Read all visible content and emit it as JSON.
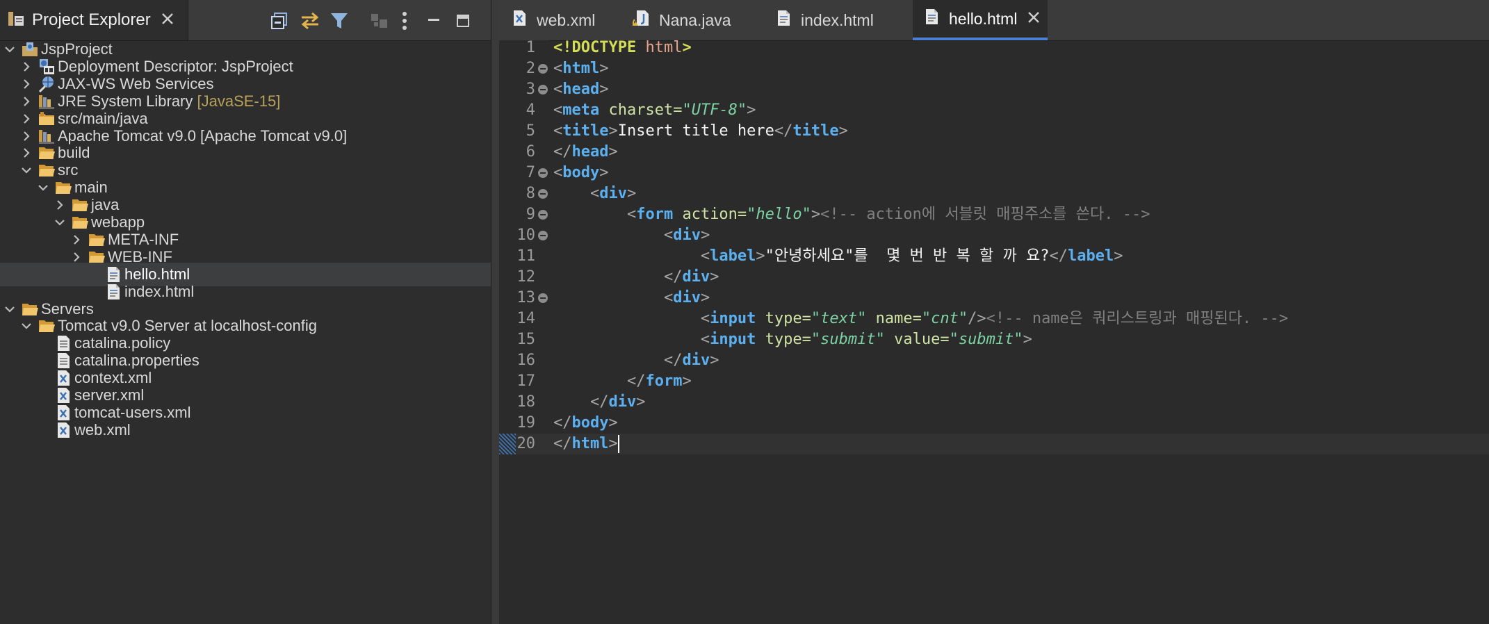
{
  "explorer": {
    "title": "Project Explorer",
    "toolbar": [
      "collapse-all-icon",
      "link-with-editor-icon",
      "filter-icon",
      "focus-icon",
      "view-menu-icon",
      "minimize-icon",
      "maximize-icon"
    ],
    "tree": [
      {
        "label": "JspProject",
        "deco": "",
        "level": 0,
        "expanded": true,
        "has_children": true,
        "icon": "project-icon"
      },
      {
        "label": "Deployment Descriptor: JspProject",
        "deco": "",
        "level": 1,
        "expanded": false,
        "has_children": true,
        "icon": "deployment-descriptor-icon"
      },
      {
        "label": "JAX-WS Web Services",
        "deco": "",
        "level": 1,
        "expanded": false,
        "has_children": true,
        "icon": "web-services-icon"
      },
      {
        "label": "JRE System Library",
        "deco": " [JavaSE-15]",
        "level": 1,
        "expanded": false,
        "has_children": true,
        "icon": "library-icon"
      },
      {
        "label": "src/main/java",
        "deco": "",
        "level": 1,
        "expanded": false,
        "has_children": true,
        "icon": "source-folder-icon"
      },
      {
        "label": "Apache Tomcat v9.0 [Apache Tomcat v9.0]",
        "deco": "",
        "level": 1,
        "expanded": false,
        "has_children": true,
        "icon": "library-icon"
      },
      {
        "label": "build",
        "deco": "",
        "level": 1,
        "expanded": false,
        "has_children": true,
        "icon": "folder-icon"
      },
      {
        "label": "src",
        "deco": "",
        "level": 1,
        "expanded": true,
        "has_children": true,
        "icon": "folder-icon"
      },
      {
        "label": "main",
        "deco": "",
        "level": 2,
        "expanded": true,
        "has_children": true,
        "icon": "folder-icon"
      },
      {
        "label": "java",
        "deco": "",
        "level": 3,
        "expanded": false,
        "has_children": true,
        "icon": "folder-icon"
      },
      {
        "label": "webapp",
        "deco": "",
        "level": 3,
        "expanded": true,
        "has_children": true,
        "icon": "folder-icon"
      },
      {
        "label": "META-INF",
        "deco": "",
        "level": 4,
        "expanded": false,
        "has_children": true,
        "icon": "folder-icon"
      },
      {
        "label": "WEB-INF",
        "deco": "",
        "level": 4,
        "expanded": false,
        "has_children": true,
        "icon": "folder-icon"
      },
      {
        "label": "hello.html",
        "deco": "",
        "level": 5,
        "expanded": false,
        "has_children": false,
        "icon": "html-file-icon",
        "selected": true
      },
      {
        "label": "index.html",
        "deco": "",
        "level": 5,
        "expanded": false,
        "has_children": false,
        "icon": "html-file-icon"
      },
      {
        "label": "Servers",
        "deco": "",
        "level": 0,
        "expanded": true,
        "has_children": true,
        "icon": "folder-icon"
      },
      {
        "label": "Tomcat v9.0 Server at localhost-config",
        "deco": "",
        "level": 1,
        "expanded": true,
        "has_children": true,
        "icon": "folder-icon"
      },
      {
        "label": "catalina.policy",
        "deco": "",
        "level": 2,
        "expanded": false,
        "has_children": false,
        "icon": "text-file-icon"
      },
      {
        "label": "catalina.properties",
        "deco": "",
        "level": 2,
        "expanded": false,
        "has_children": false,
        "icon": "text-file-icon"
      },
      {
        "label": "context.xml",
        "deco": "",
        "level": 2,
        "expanded": false,
        "has_children": false,
        "icon": "xml-file-icon"
      },
      {
        "label": "server.xml",
        "deco": "",
        "level": 2,
        "expanded": false,
        "has_children": false,
        "icon": "xml-file-icon"
      },
      {
        "label": "tomcat-users.xml",
        "deco": "",
        "level": 2,
        "expanded": false,
        "has_children": false,
        "icon": "xml-file-icon"
      },
      {
        "label": "web.xml",
        "deco": "",
        "level": 2,
        "expanded": false,
        "has_children": false,
        "icon": "xml-file-icon"
      }
    ]
  },
  "editor": {
    "tabs": [
      {
        "label": "web.xml",
        "icon": "xml-file-icon",
        "active": false
      },
      {
        "label": "Nana.java",
        "icon": "java-file-icon",
        "active": false
      },
      {
        "label": "index.html",
        "icon": "html-file-icon",
        "active": false
      },
      {
        "label": "hello.html",
        "icon": "html-file-icon",
        "active": true
      }
    ],
    "current_line": 20,
    "lines": [
      {
        "n": "1",
        "fold": false,
        "tokens": [
          [
            "doctype",
            "<!DOCTYPE"
          ],
          [
            "text",
            " "
          ],
          [
            "doctype-name",
            "html"
          ],
          [
            "doctype",
            ">"
          ]
        ]
      },
      {
        "n": "2",
        "fold": true,
        "tokens": [
          [
            "punct",
            "<"
          ],
          [
            "tag",
            "html"
          ],
          [
            "punct",
            ">"
          ]
        ]
      },
      {
        "n": "3",
        "fold": true,
        "tokens": [
          [
            "punct",
            "<"
          ],
          [
            "tag",
            "head"
          ],
          [
            "punct",
            ">"
          ]
        ]
      },
      {
        "n": "4",
        "fold": false,
        "tokens": [
          [
            "punct",
            "<"
          ],
          [
            "tag",
            "meta"
          ],
          [
            "text",
            " "
          ],
          [
            "attr",
            "charset="
          ],
          [
            "val",
            "\"UTF-8\""
          ],
          [
            "punct",
            ">"
          ]
        ]
      },
      {
        "n": "5",
        "fold": false,
        "tokens": [
          [
            "punct",
            "<"
          ],
          [
            "tag",
            "title"
          ],
          [
            "punct",
            ">"
          ],
          [
            "text",
            "Insert title here"
          ],
          [
            "punct",
            "</"
          ],
          [
            "tag",
            "title"
          ],
          [
            "punct",
            ">"
          ]
        ]
      },
      {
        "n": "6",
        "fold": false,
        "tokens": [
          [
            "punct",
            "</"
          ],
          [
            "tag",
            "head"
          ],
          [
            "punct",
            ">"
          ]
        ]
      },
      {
        "n": "7",
        "fold": true,
        "tokens": [
          [
            "punct",
            "<"
          ],
          [
            "tag",
            "body"
          ],
          [
            "punct",
            ">"
          ]
        ]
      },
      {
        "n": "8",
        "fold": true,
        "tokens": [
          [
            "text",
            "    "
          ],
          [
            "punct",
            "<"
          ],
          [
            "tag",
            "div"
          ],
          [
            "punct",
            ">"
          ]
        ]
      },
      {
        "n": "9",
        "fold": true,
        "tokens": [
          [
            "text",
            "        "
          ],
          [
            "punct",
            "<"
          ],
          [
            "tag",
            "form"
          ],
          [
            "text",
            " "
          ],
          [
            "attr",
            "action="
          ],
          [
            "val",
            "\"hello\""
          ],
          [
            "punct",
            ">"
          ],
          [
            "comment",
            "<!-- action에 서블릿 매핑주소를 쓴다. -->"
          ]
        ]
      },
      {
        "n": "10",
        "fold": true,
        "tokens": [
          [
            "text",
            "            "
          ],
          [
            "punct",
            "<"
          ],
          [
            "tag",
            "div"
          ],
          [
            "punct",
            ">"
          ]
        ]
      },
      {
        "n": "11",
        "fold": false,
        "tokens": [
          [
            "text",
            "                "
          ],
          [
            "punct",
            "<"
          ],
          [
            "tag",
            "label"
          ],
          [
            "punct",
            ">"
          ],
          [
            "text",
            "\"안녕하세요\"를  몇 번 반 복 할 까 요?"
          ],
          [
            "punct",
            "</"
          ],
          [
            "tag",
            "label"
          ],
          [
            "punct",
            ">"
          ]
        ]
      },
      {
        "n": "12",
        "fold": false,
        "tokens": [
          [
            "text",
            "            "
          ],
          [
            "punct",
            "</"
          ],
          [
            "tag",
            "div"
          ],
          [
            "punct",
            ">"
          ]
        ]
      },
      {
        "n": "13",
        "fold": true,
        "tokens": [
          [
            "text",
            "            "
          ],
          [
            "punct",
            "<"
          ],
          [
            "tag",
            "div"
          ],
          [
            "punct",
            ">"
          ]
        ]
      },
      {
        "n": "14",
        "fold": false,
        "tokens": [
          [
            "text",
            "                "
          ],
          [
            "punct",
            "<"
          ],
          [
            "tag",
            "input"
          ],
          [
            "text",
            " "
          ],
          [
            "attr",
            "type="
          ],
          [
            "val",
            "\"text\""
          ],
          [
            "text",
            " "
          ],
          [
            "attr",
            "name="
          ],
          [
            "val",
            "\"cnt\""
          ],
          [
            "punct",
            "/>"
          ],
          [
            "comment",
            "<!-- name은 쿼리스트링과 매핑된다. -->"
          ]
        ]
      },
      {
        "n": "15",
        "fold": false,
        "tokens": [
          [
            "text",
            "                "
          ],
          [
            "punct",
            "<"
          ],
          [
            "tag",
            "input"
          ],
          [
            "text",
            " "
          ],
          [
            "attr",
            "type="
          ],
          [
            "val",
            "\"submit\""
          ],
          [
            "text",
            " "
          ],
          [
            "attr",
            "value="
          ],
          [
            "val",
            "\"submit\""
          ],
          [
            "punct",
            ">"
          ]
        ]
      },
      {
        "n": "16",
        "fold": false,
        "tokens": [
          [
            "text",
            "            "
          ],
          [
            "punct",
            "</"
          ],
          [
            "tag",
            "div"
          ],
          [
            "punct",
            ">"
          ]
        ]
      },
      {
        "n": "17",
        "fold": false,
        "tokens": [
          [
            "text",
            "        "
          ],
          [
            "punct",
            "</"
          ],
          [
            "tag",
            "form"
          ],
          [
            "punct",
            ">"
          ]
        ]
      },
      {
        "n": "18",
        "fold": false,
        "tokens": [
          [
            "text",
            "    "
          ],
          [
            "punct",
            "</"
          ],
          [
            "tag",
            "div"
          ],
          [
            "punct",
            ">"
          ]
        ]
      },
      {
        "n": "19",
        "fold": false,
        "tokens": [
          [
            "punct",
            "</"
          ],
          [
            "tag",
            "body"
          ],
          [
            "punct",
            ">"
          ]
        ]
      },
      {
        "n": "20",
        "fold": false,
        "tokens": [
          [
            "punct",
            "</"
          ],
          [
            "tag",
            "html"
          ],
          [
            "punct",
            ">"
          ]
        ]
      }
    ]
  }
}
